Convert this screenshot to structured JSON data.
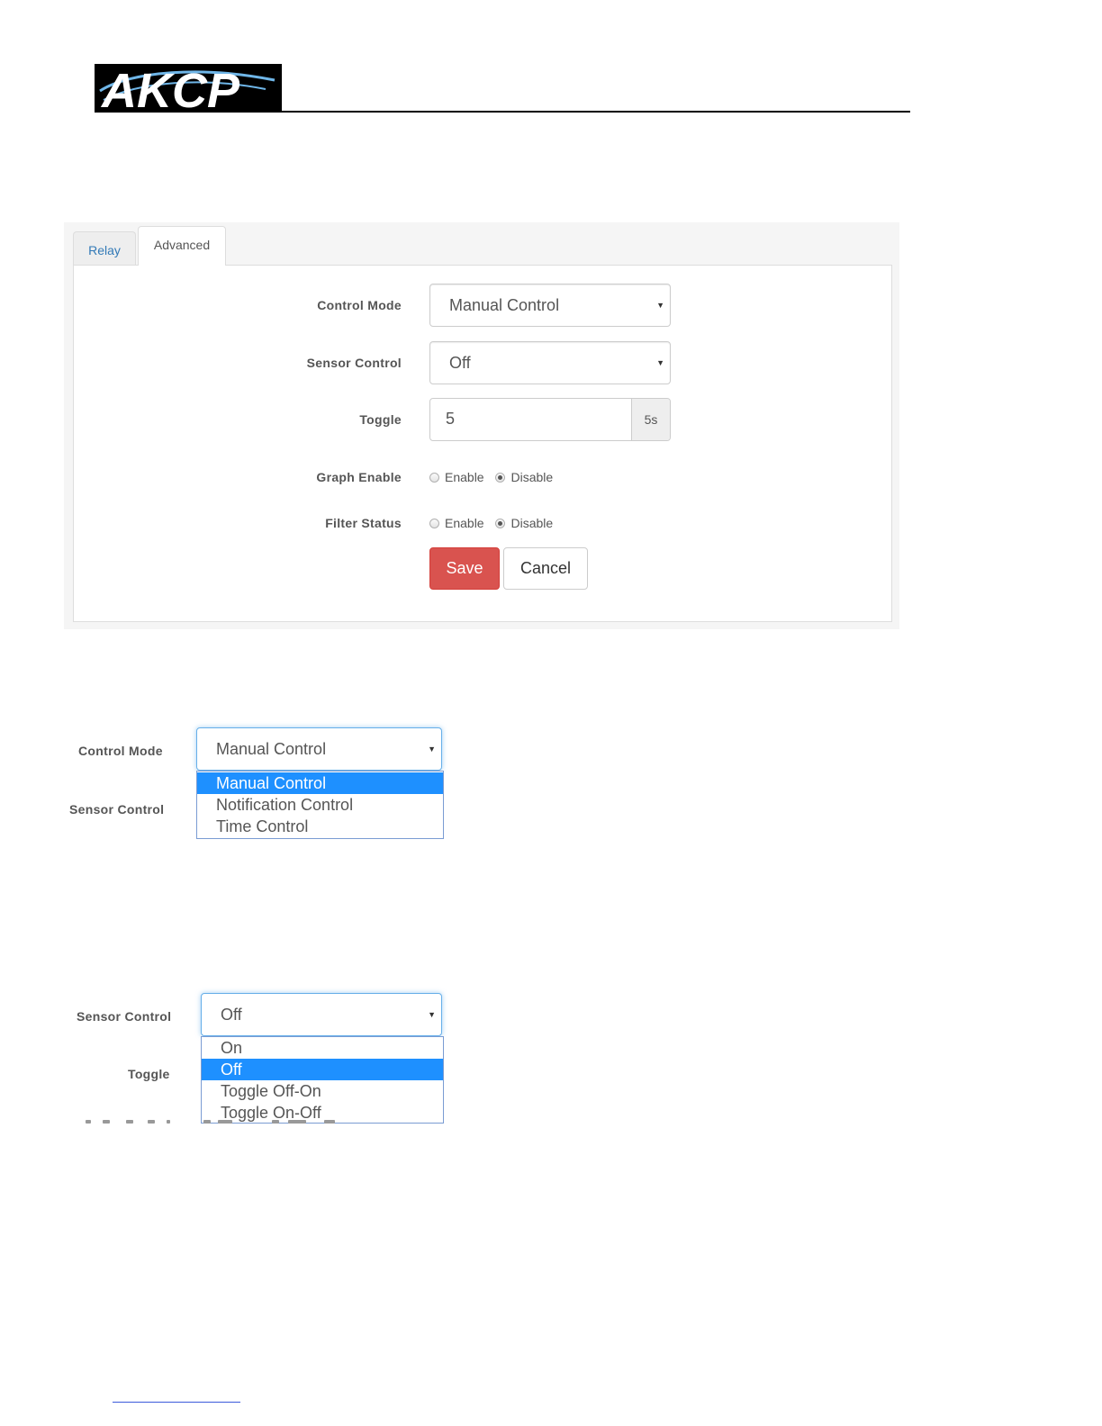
{
  "brand": {
    "logo_text": "AKCP"
  },
  "panel": {
    "tabs": [
      {
        "label": "Relay",
        "active": false
      },
      {
        "label": "Advanced",
        "active": true
      }
    ],
    "fields": {
      "control_mode": {
        "label": "Control Mode",
        "value": "Manual Control"
      },
      "sensor_control": {
        "label": "Sensor Control",
        "value": "Off"
      },
      "toggle": {
        "label": "Toggle",
        "value": "5",
        "unit": "5s"
      },
      "graph_enable": {
        "label": "Graph Enable",
        "options": [
          "Enable",
          "Disable"
        ],
        "selected": "Disable"
      },
      "filter_status": {
        "label": "Filter Status",
        "options": [
          "Enable",
          "Disable"
        ],
        "selected": "Disable"
      }
    },
    "buttons": {
      "save": "Save",
      "cancel": "Cancel"
    }
  },
  "control_mode_dropdown": {
    "label": "Control Mode",
    "below_label": "Sensor Control",
    "value": "Manual Control",
    "options": [
      "Manual Control",
      "Notification Control",
      "Time Control"
    ],
    "selected_index": 0
  },
  "sensor_control_dropdown": {
    "label": "Sensor Control",
    "below_label": "Toggle",
    "value": "Off",
    "options": [
      "On",
      "Off",
      "Toggle Off-On",
      "Toggle On-Off"
    ],
    "selected_index": 1
  },
  "colors": {
    "save_button": "#d9534f",
    "link_blue": "#337ab7",
    "selected_option": "#1e90ff"
  }
}
